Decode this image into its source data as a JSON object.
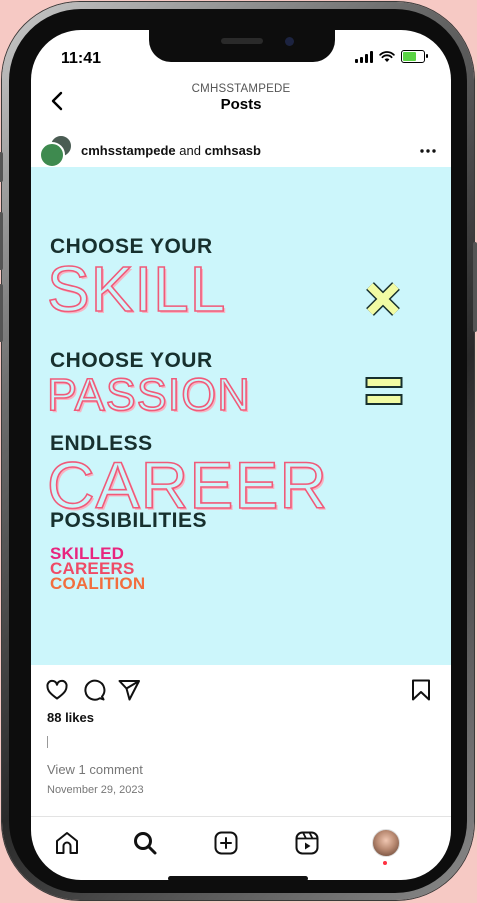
{
  "status_bar": {
    "time": "11:41"
  },
  "header": {
    "account": "CMHSSTAMPEDE",
    "title": "Posts"
  },
  "post_author": {
    "primary": "cmhsstampede",
    "connector": "and",
    "secondary": "cmhsasb"
  },
  "post_image": {
    "line1": "CHOOSE YOUR",
    "big1": "SKILL",
    "line2": "CHOOSE YOUR",
    "big2": "PASSION",
    "line3": "ENDLESS",
    "big3": "CAREER",
    "line4": "POSSIBILITIES",
    "brand": [
      "SKILLED",
      "CAREERS",
      "COALITION"
    ],
    "colors": {
      "background": "#ccf6fb",
      "outline": "#f05a79",
      "symbol": "#f1fba3",
      "dark_text": "#17302e"
    }
  },
  "engagement": {
    "likes": "88 likes",
    "view_comments": "View 1 comment",
    "date": "November 29, 2023"
  },
  "icons": [
    "back-icon",
    "more-icon",
    "heart-icon",
    "comment-icon",
    "share-icon",
    "bookmark-icon",
    "home-icon",
    "search-icon",
    "create-icon",
    "reels-icon",
    "profile-avatar"
  ]
}
